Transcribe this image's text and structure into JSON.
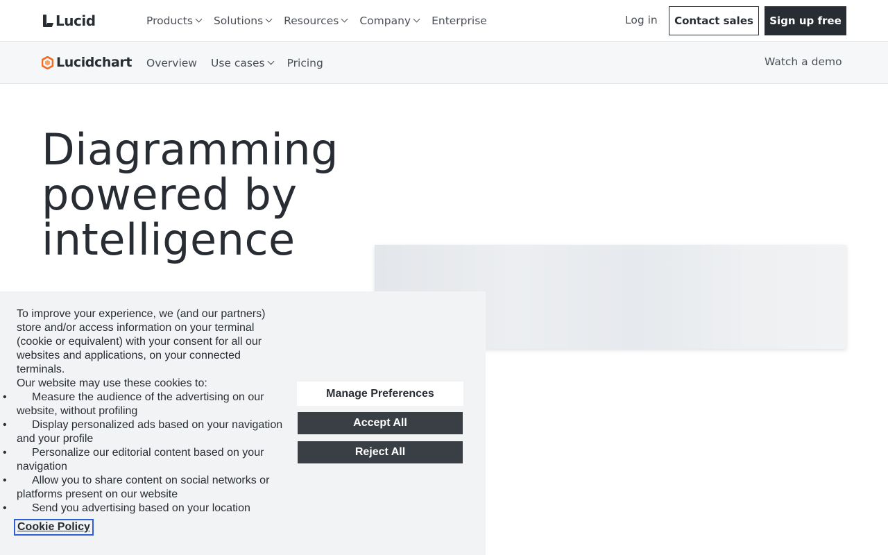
{
  "topnav": {
    "logo_text": "Lucid",
    "menu": [
      {
        "label": "Products",
        "has_dropdown": true
      },
      {
        "label": "Solutions",
        "has_dropdown": true
      },
      {
        "label": "Resources",
        "has_dropdown": true
      },
      {
        "label": "Company",
        "has_dropdown": true
      },
      {
        "label": "Enterprise",
        "has_dropdown": false
      }
    ],
    "login_label": "Log in",
    "contact_label": "Contact sales",
    "signup_label": "Sign up free"
  },
  "subnav": {
    "logo_text": "Lucidchart",
    "logo_color": "#f26b21",
    "menu": [
      {
        "label": "Overview",
        "has_dropdown": false
      },
      {
        "label": "Use cases",
        "has_dropdown": true
      },
      {
        "label": "Pricing",
        "has_dropdown": false
      }
    ],
    "watch_demo_label": "Watch a demo"
  },
  "hero": {
    "title_lines": [
      "Diagramming",
      "powered by",
      "intelligence"
    ]
  },
  "cookie_banner": {
    "intro": "To improve your experience, we (and our partners) store and/or access information on your terminal (cookie or equivalent) with your consent for all our websites and applications, on your connected terminals.",
    "list_intro": "Our website may use these cookies to:",
    "items": [
      "Measure the audience of the advertising on our website, without profiling",
      "Display personalized ads based on your navigation and your profile",
      "Personalize our editorial content based on your navigation",
      "Allow you to share content on social networks or platforms present on our website",
      "Send you advertising based on your location"
    ],
    "policy_link": "Cookie Policy",
    "manage_label": "Manage Preferences",
    "accept_label": "Accept All",
    "reject_label": "Reject All"
  }
}
